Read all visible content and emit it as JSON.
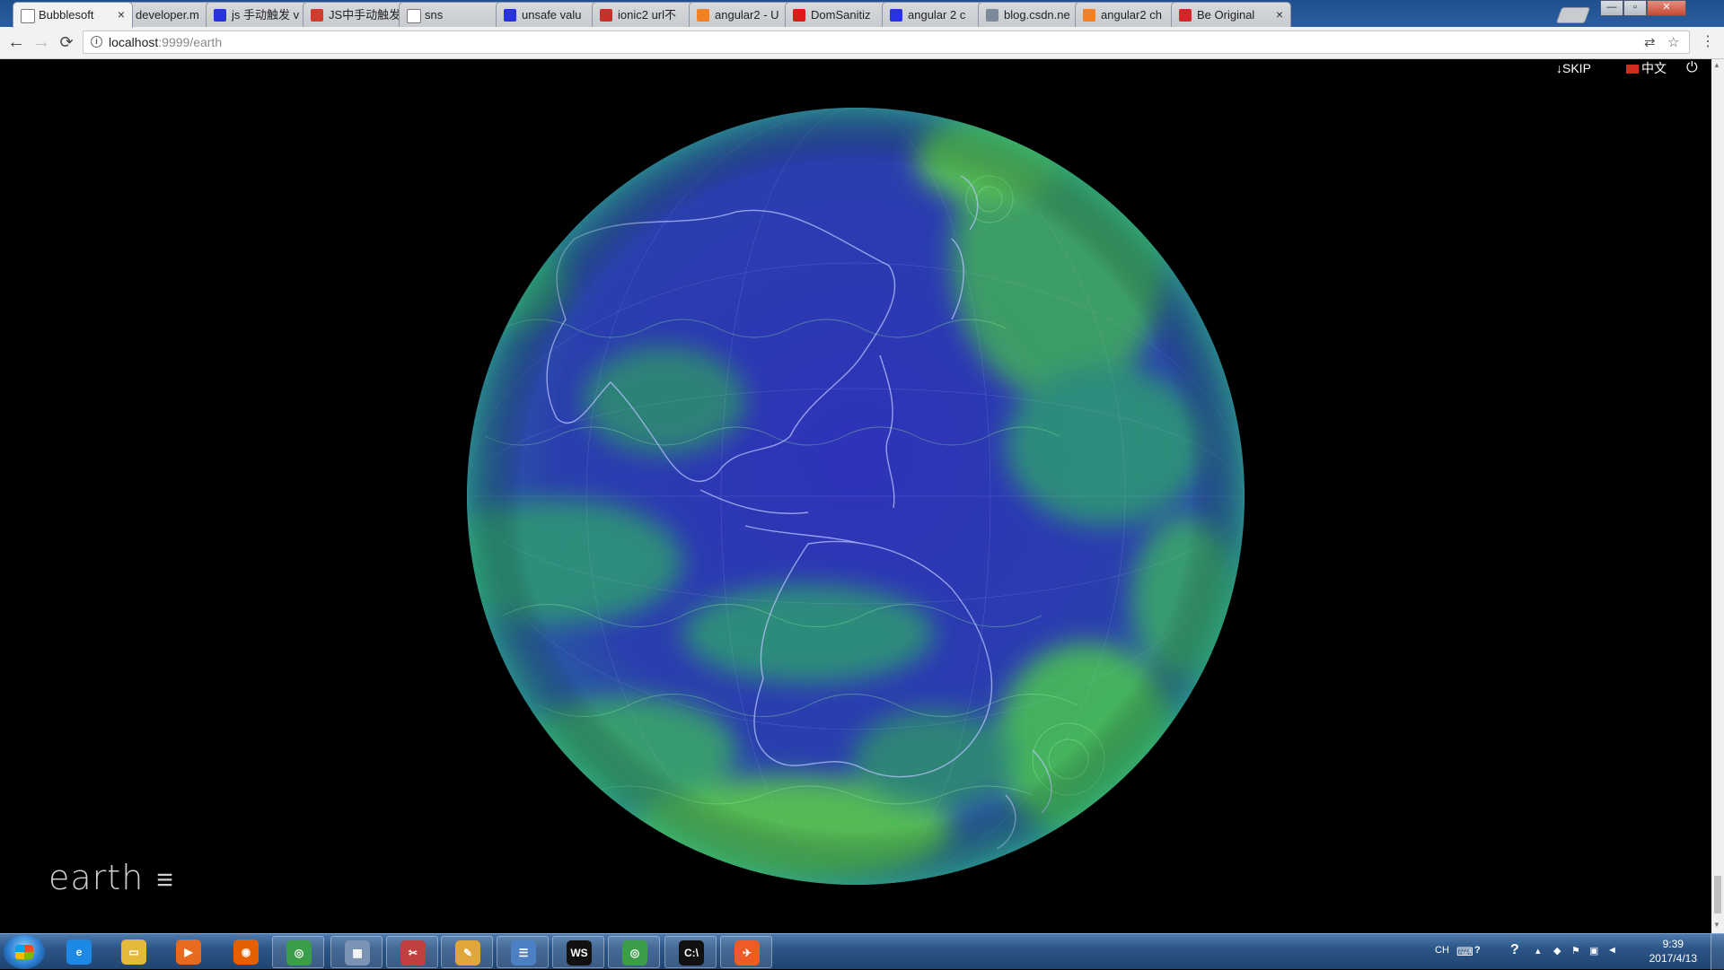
{
  "browser": {
    "tabs": [
      {
        "label": "Bubblesoft",
        "favicon": "page-icon",
        "fav_color": "#ffffff",
        "active": true
      },
      {
        "label": "developer.m",
        "favicon": "developer-icon",
        "fav_color": "#6b7a8f"
      },
      {
        "label": "js 手动触发 v",
        "favicon": "baidu-paw-icon",
        "fav_color": "#2932e1"
      },
      {
        "label": "JS中手动触发",
        "favicon": "colorful-icon",
        "fav_color": "#d23b2b"
      },
      {
        "label": "sns",
        "favicon": "page-icon",
        "fav_color": "#ffffff"
      },
      {
        "label": "unsafe valu",
        "favicon": "baidu-paw-icon",
        "fav_color": "#2932e1"
      },
      {
        "label": "ionic2 url不",
        "favicon": "csdn-c-icon",
        "fav_color": "#c9302c"
      },
      {
        "label": "angular2 - U",
        "favicon": "stackoverflow-icon",
        "fav_color": "#f48024"
      },
      {
        "label": "DomSanitiz",
        "favicon": "angular-icon",
        "fav_color": "#dd1b16"
      },
      {
        "label": "angular 2 c",
        "favicon": "baidu-paw-icon",
        "fav_color": "#2932e1"
      },
      {
        "label": "blog.csdn.ne",
        "favicon": "csdn-c-icon-grey",
        "fav_color": "#7a8a9a"
      },
      {
        "label": "angular2 ch",
        "favicon": "stackoverflow-icon",
        "fav_color": "#f48024"
      },
      {
        "label": "Be Original",
        "favicon": "segmentfault-s-icon",
        "fav_color": "#d8232a"
      }
    ],
    "tab_close_glyph": "×",
    "window_controls": {
      "minimize": "—",
      "maximize": "▫",
      "close": "✕"
    },
    "url_host": "localhost",
    "url_path": ":9999/earth",
    "nav": {
      "back": "←",
      "forward": "→",
      "reload": "⟳"
    },
    "omnibox_icons": {
      "translate": "⇄",
      "star": "☆"
    },
    "menu_glyph": "⋮"
  },
  "page": {
    "skip_label": "SKIP",
    "skip_icon": "↓",
    "lang_label": "中文",
    "power_icon": "⏻",
    "earth_title": "earth",
    "menu_icon": "≡",
    "colors": {
      "ocean_low": "#2a2bb0",
      "wind_mid": "#2f8f6e",
      "wind_high": "#6fe84a",
      "coast": "#b8c4ff"
    }
  },
  "taskbar": {
    "apps": [
      {
        "name": "ie",
        "glyph": "e",
        "color": "#1e88e5"
      },
      {
        "name": "explorer",
        "glyph": "▭",
        "color": "#e5b93a"
      },
      {
        "name": "media-player",
        "glyph": "▶",
        "color": "#e86a1e"
      },
      {
        "name": "firefox",
        "glyph": "◉",
        "color": "#e66000"
      },
      {
        "name": "chrome",
        "glyph": "◎",
        "color": "#3a9d47",
        "pinned": true
      },
      {
        "name": "calculator",
        "glyph": "▦",
        "color": "#7b94b5",
        "pinned": true
      },
      {
        "name": "snipping",
        "glyph": "✂",
        "color": "#c04040",
        "pinned": true
      },
      {
        "name": "paint",
        "glyph": "✎",
        "color": "#e0a63a",
        "pinned": true
      },
      {
        "name": "messages",
        "glyph": "☰",
        "color": "#4d7fc4",
        "pinned": true
      },
      {
        "name": "webstorm",
        "glyph": "WS",
        "color": "#111111",
        "pinned": true
      },
      {
        "name": "chrome-2",
        "glyph": "◎",
        "color": "#3a9d47",
        "pinned": true
      },
      {
        "name": "cmd",
        "glyph": "C:\\",
        "color": "#111111",
        "pinned": true
      },
      {
        "name": "postman",
        "glyph": "✈",
        "color": "#ef5b25",
        "pinned": true
      }
    ],
    "tray": {
      "lang": "CH",
      "keyboard_icon": "⌨",
      "help_icon": "?",
      "chevron_icon": "▴",
      "time": "9:39",
      "date": "2017/4/13"
    }
  }
}
